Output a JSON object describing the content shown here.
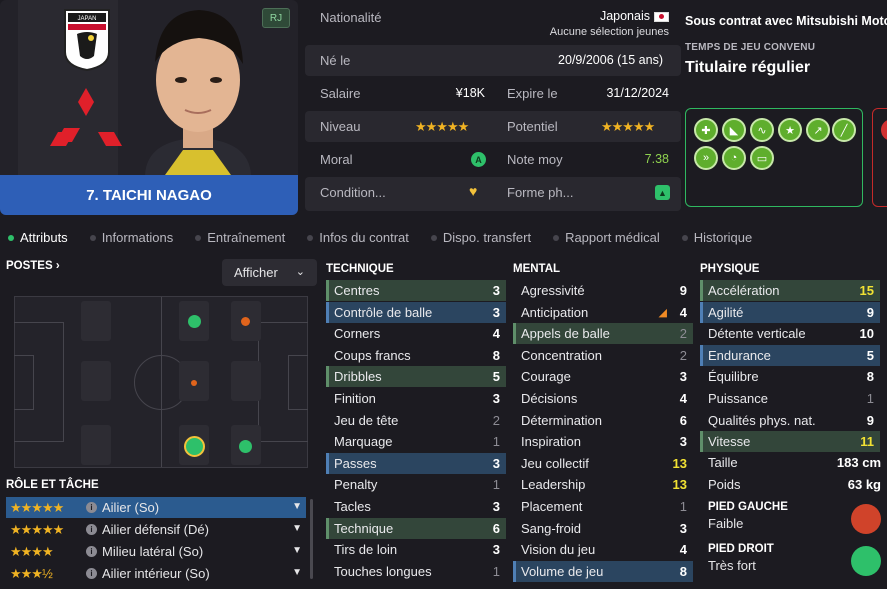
{
  "player": {
    "rj_badge": "RJ",
    "name": "7. TAICHI NAGAO",
    "crest_text": "JAPAN"
  },
  "info": {
    "nationalite_label": "Nationalité",
    "nationalite_value": "Japonais",
    "selection": "Aucune sélection jeunes",
    "ne_le_label": "Né le",
    "ne_le_value": "20/9/2006 (15 ans)",
    "salaire_label": "Salaire",
    "salaire_value": "¥18K",
    "expire_label": "Expire le",
    "expire_value": "31/12/2024",
    "niveau_label": "Niveau",
    "niveau_stars": "★★★★★",
    "potentiel_label": "Potentiel",
    "potentiel_stars": "★★★★★",
    "moral_label": "Moral",
    "moral_icon": "A",
    "note_label": "Note moy",
    "note_value": "7.38",
    "condition_label": "Condition...",
    "forme_label": "Forme ph..."
  },
  "contract": {
    "heading": "Sous contrat avec Mitsubishi Motors",
    "playtime_label": "TEMPS DE JEU CONVENU",
    "playtime_value": "Titulaire régulier"
  },
  "traits": [
    "medical-icon",
    "boot-icon",
    "curve-icon",
    "star-icon",
    "trend-up-icon",
    "bandage-icon",
    "running-boots-icon",
    "clock-boot-icon",
    "pitch-icon"
  ],
  "tabs": [
    "Attributs",
    "Informations",
    "Entraînement",
    "Infos du contrat",
    "Dispo. transfert",
    "Rapport médical",
    "Historique"
  ],
  "positions": {
    "title": "POSTES",
    "afficher": "Afficher"
  },
  "roles": {
    "title": "RÔLE ET TÂCHE",
    "items": [
      {
        "stars": "★★★★★",
        "label": "Ailier (So)"
      },
      {
        "stars": "★★★★★",
        "label": "Ailier défensif (Dé)"
      },
      {
        "stars": "★★★★",
        "label": "Milieu latéral (So)"
      },
      {
        "stars": "★★★½",
        "label": "Ailier intérieur (So)"
      }
    ]
  },
  "technique": {
    "title": "TECHNIQUE",
    "rows": [
      {
        "name": "Centres",
        "value": "3"
      },
      {
        "name": "Contrôle de balle",
        "value": "3"
      },
      {
        "name": "Corners",
        "value": "4"
      },
      {
        "name": "Coups francs",
        "value": "8"
      },
      {
        "name": "Dribbles",
        "value": "5"
      },
      {
        "name": "Finition",
        "value": "3"
      },
      {
        "name": "Jeu de tête",
        "value": "2"
      },
      {
        "name": "Marquage",
        "value": "1"
      },
      {
        "name": "Passes",
        "value": "3"
      },
      {
        "name": "Penalty",
        "value": "1"
      },
      {
        "name": "Tacles",
        "value": "3"
      },
      {
        "name": "Technique",
        "value": "6"
      },
      {
        "name": "Tirs de loin",
        "value": "3"
      },
      {
        "name": "Touches longues",
        "value": "1"
      }
    ]
  },
  "mental": {
    "title": "MENTAL",
    "rows": [
      {
        "name": "Agressivité",
        "value": "9"
      },
      {
        "name": "Anticipation",
        "value": "4"
      },
      {
        "name": "Appels de balle",
        "value": "2"
      },
      {
        "name": "Concentration",
        "value": "2"
      },
      {
        "name": "Courage",
        "value": "3"
      },
      {
        "name": "Décisions",
        "value": "4"
      },
      {
        "name": "Détermination",
        "value": "6"
      },
      {
        "name": "Inspiration",
        "value": "3"
      },
      {
        "name": "Jeu collectif",
        "value": "13"
      },
      {
        "name": "Leadership",
        "value": "13"
      },
      {
        "name": "Placement",
        "value": "1"
      },
      {
        "name": "Sang-froid",
        "value": "3"
      },
      {
        "name": "Vision du jeu",
        "value": "4"
      },
      {
        "name": "Volume de jeu",
        "value": "8"
      }
    ]
  },
  "physique": {
    "title": "PHYSIQUE",
    "rows": [
      {
        "name": "Accélération",
        "value": "15"
      },
      {
        "name": "Agilité",
        "value": "9"
      },
      {
        "name": "Détente verticale",
        "value": "10"
      },
      {
        "name": "Endurance",
        "value": "5"
      },
      {
        "name": "Équilibre",
        "value": "8"
      },
      {
        "name": "Puissance",
        "value": "1"
      },
      {
        "name": "Qualités phys. nat.",
        "value": "9"
      },
      {
        "name": "Vitesse",
        "value": "11"
      }
    ],
    "taille_label": "Taille",
    "taille_value": "183 cm",
    "poids_label": "Poids",
    "poids_value": "63 kg"
  },
  "feet": {
    "left_title": "PIED GAUCHE",
    "left_value": "Faible",
    "right_title": "PIED DROIT",
    "right_value": "Très fort"
  }
}
